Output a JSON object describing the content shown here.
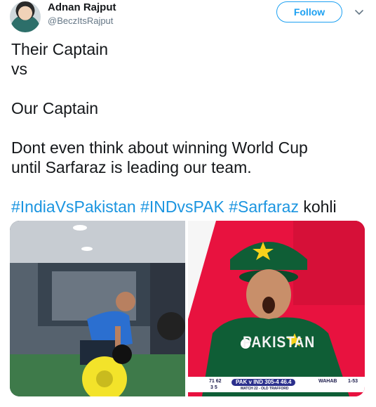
{
  "author": {
    "name": "Adnan Rajput",
    "handle": "@BeczItsRajput"
  },
  "follow_button": {
    "label": "Follow"
  },
  "tweet": {
    "lines": [
      "Their Captain",
      "vs",
      "Our Captain",
      "Dont even think about winning World Cup",
      "until Sarfaraz is leading our team."
    ],
    "hashtags": [
      "#IndiaVsPakistan",
      "#INDvsPAK",
      "#Sarfaraz"
    ],
    "trailing_word": "kohli"
  },
  "media": {
    "right": {
      "jersey_text": "PAKISTAN",
      "scoreboard": {
        "left_figures": "71 62",
        "left_figures_sub": "3 5",
        "teams": "PAK v IND",
        "score": "305-4",
        "overs": "46.4",
        "bowler": "WAHAB",
        "bowler_figures": "1-53",
        "match_info": "MATCH 22 - OLD TRAFFORD"
      }
    }
  },
  "colors": {
    "follow": "#1da1f2",
    "hashtag": "#1b95e0",
    "handle": "#657786"
  },
  "icons": {
    "menu": "chevron-down-icon"
  }
}
